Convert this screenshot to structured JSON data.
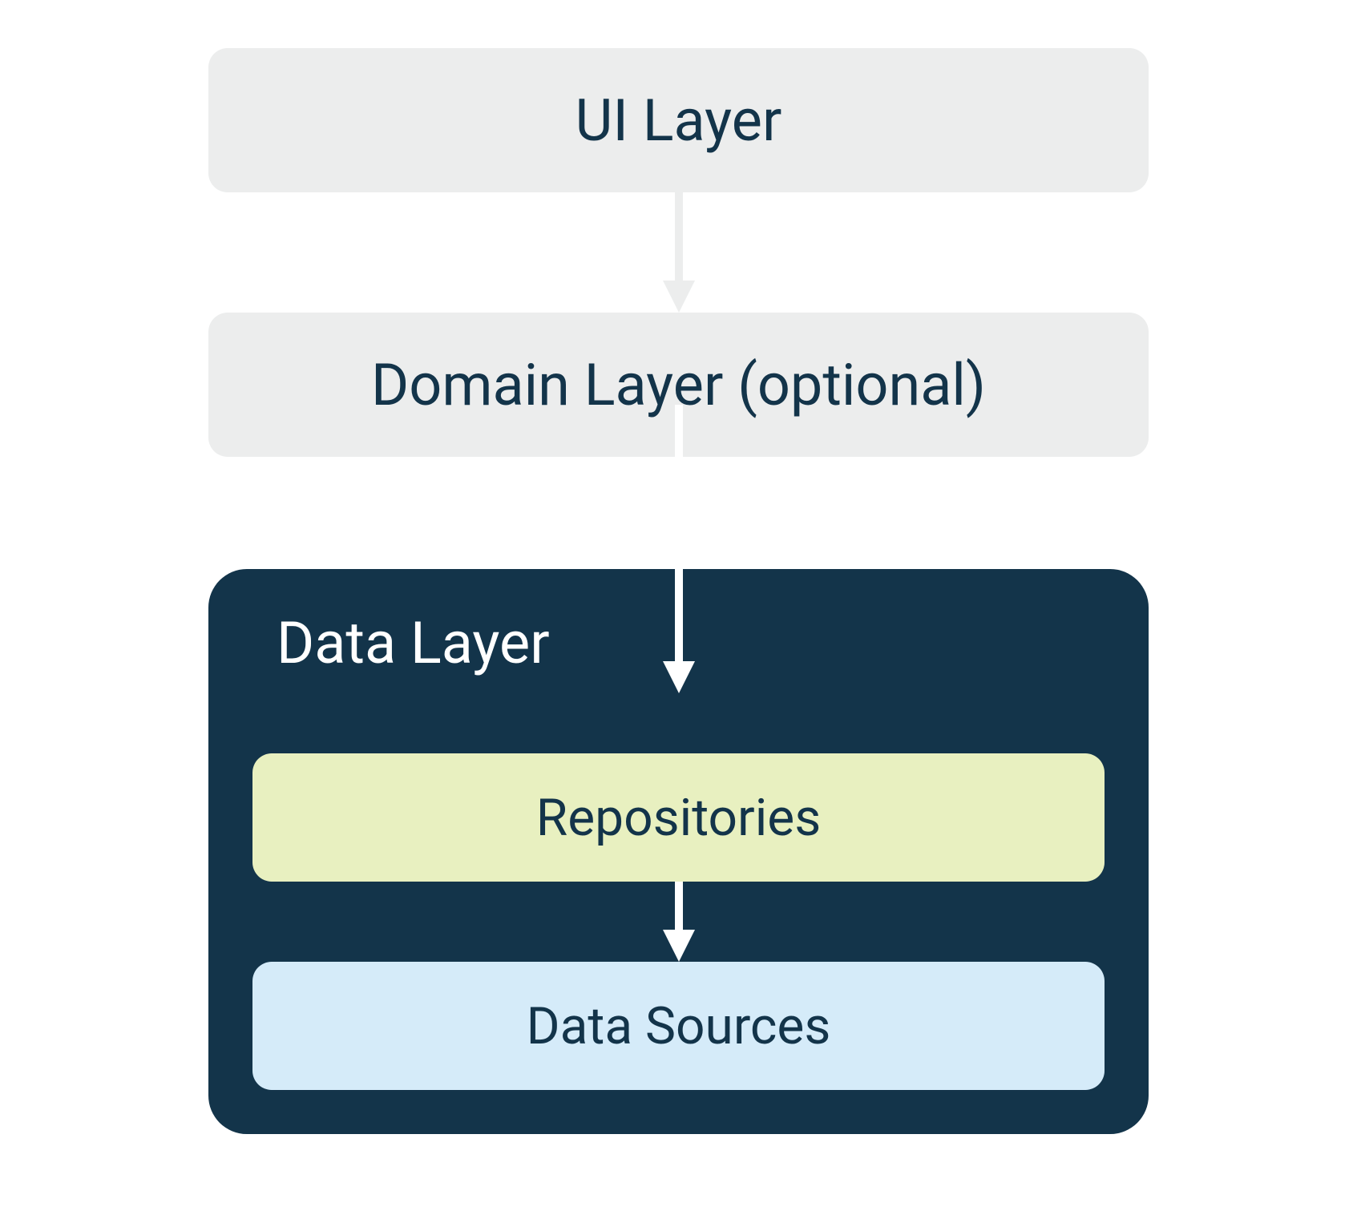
{
  "layers": {
    "ui": "UI Layer",
    "domain": "Domain Layer (optional)",
    "data": {
      "title": "Data Layer",
      "repositories": "Repositories",
      "dataSources": "Data Sources"
    }
  },
  "colors": {
    "lightGray": "#eceded",
    "darkBlue": "#13344a",
    "lightGreen": "#e8f0c0",
    "lightBlue": "#d5ebf9",
    "white": "#ffffff"
  }
}
